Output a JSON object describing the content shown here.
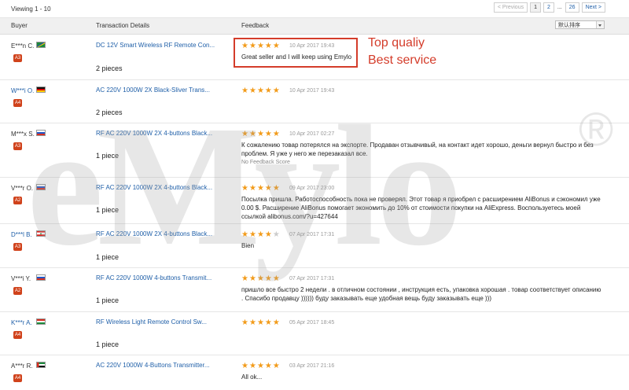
{
  "viewing": "Viewing 1 - 10",
  "pagination": {
    "prev": "< Previous",
    "pages": [
      "1",
      "2"
    ],
    "ellipsis": "...",
    "last": "26",
    "next": "Next >"
  },
  "columns": {
    "buyer": "Buyer",
    "transaction": "Transaction Details",
    "feedback": "Feedback"
  },
  "sort": {
    "selected": "默认排序"
  },
  "annotation": {
    "line1": "Top qualiy",
    "line2": "Best service"
  },
  "watermark": "eMylo",
  "watermark_mark": "®",
  "rows": [
    {
      "buyer": "E***n C.",
      "level": "A3",
      "product": "DC 12V Smart Wireless RF Remote Con...",
      "quantity": "2 pieces",
      "stars": 5,
      "date": "10 Apr 2017 19:43",
      "feedback": "Great seller and I will keep using Emylo",
      "sub": ""
    },
    {
      "buyer": "W***i O.",
      "level": "A4",
      "product": "AC 220V 1000W 2X Black-Sliver Trans...",
      "quantity": "2 pieces",
      "stars": 5,
      "date": "10 Apr 2017 19:43",
      "feedback": "",
      "sub": ""
    },
    {
      "buyer": "M***x S.",
      "level": "A3",
      "product": "RF AC 220V 1000W 2X 4-buttons Black...",
      "quantity": "1 piece",
      "stars": 5,
      "date": "10 Apr 2017 02:27",
      "feedback": "К сожалению товар потерялся на экспорте. Продаван отзывчивый, на контакт идет хорошо, деньги вернул быстро и без проблем. Я уже у него же перезаказал все.",
      "sub": "No Feedback Score"
    },
    {
      "buyer": "V***r O.",
      "level": "A2",
      "product": "RF AC 220V 1000W 2X 4-buttons Black...",
      "quantity": "1 piece",
      "stars": 5,
      "date": "09 Apr 2017 23:00",
      "feedback": "Посылка пришла. Работоспособность пока не проверял. Этот товар я приобрел с расширением AliBonus и сэкономил уже 0.00 $. Расширение AliBonus помогает экономить до 10% от стоимости покупки на AliExpress. Воспользуетесь моей ссылкой alibonus.com/?u=427644",
      "sub": ""
    },
    {
      "buyer": "D***l B.",
      "level": "A3",
      "product": "RF AC 220V 1000W 2X 4-buttons Black...",
      "quantity": "1 piece",
      "stars": 4,
      "date": "07 Apr 2017 17:31",
      "feedback": "Bien",
      "sub": ""
    },
    {
      "buyer": "V***i Y.",
      "level": "A2",
      "product": "RF AC 220V 1000W 4-buttons Transmit...",
      "quantity": "1 piece",
      "stars": 5,
      "date": "07 Apr 2017 17:31",
      "feedback": "пришло все быстро 2 недели . в отличном состоянии , инструкция есть, упаковка хорошая . товар соответствует описанию . Спасибо продавцу )))))) буду заказывать еще удобная вещь буду заказывать еще )))",
      "sub": ""
    },
    {
      "buyer": "K***r A.",
      "level": "A4",
      "product": "RF Wireless Light Remote Control Sw...",
      "quantity": "1 piece",
      "stars": 5,
      "date": "05 Apr 2017 18:45",
      "feedback": "",
      "sub": ""
    },
    {
      "buyer": "A***r R.",
      "level": "A4",
      "product": "AC 220V 1000W 4-Buttons Transmitter...",
      "quantity": "",
      "stars": 5,
      "date": "03 Apr 2017 21:16",
      "feedback": "All ok...",
      "sub": ""
    }
  ],
  "colors": {
    "link": "#1f5fa8",
    "star": "#f29b1a",
    "badge": "#d0421b",
    "annotation": "#d43c2a"
  }
}
